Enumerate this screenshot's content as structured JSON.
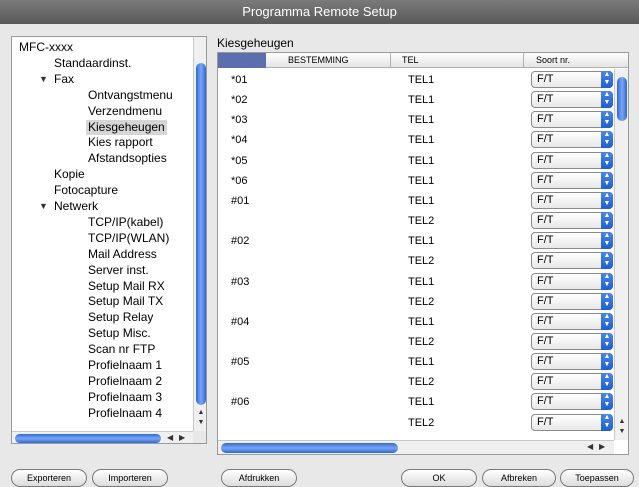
{
  "window": {
    "title": "Programma Remote Setup"
  },
  "tree": {
    "items": [
      {
        "label": "MFC-xxxx",
        "level": 0,
        "expanded": true
      },
      {
        "label": "Standaardinst.",
        "level": 1
      },
      {
        "label": "Fax",
        "level": 1,
        "expanded": true
      },
      {
        "label": "Ontvangstmenu",
        "level": 2
      },
      {
        "label": "Verzendmenu",
        "level": 2
      },
      {
        "label": "Kiesgeheugen",
        "level": 2,
        "selected": true
      },
      {
        "label": "Kies rapport",
        "level": 2
      },
      {
        "label": "Afstandsopties",
        "level": 2
      },
      {
        "label": "Kopie",
        "level": 1
      },
      {
        "label": "Fotocapture",
        "level": 1
      },
      {
        "label": "Netwerk",
        "level": 1,
        "expanded": true
      },
      {
        "label": "TCP/IP(kabel)",
        "level": 2
      },
      {
        "label": "TCP/IP(WLAN)",
        "level": 2
      },
      {
        "label": "Mail Address",
        "level": 2
      },
      {
        "label": "Server inst.",
        "level": 2
      },
      {
        "label": "Setup Mail RX",
        "level": 2
      },
      {
        "label": "Setup Mail TX",
        "level": 2
      },
      {
        "label": "Setup Relay",
        "level": 2
      },
      {
        "label": "Setup Misc.",
        "level": 2
      },
      {
        "label": "Scan nr FTP",
        "level": 2
      },
      {
        "label": "Profielnaam 1",
        "level": 2
      },
      {
        "label": "Profielnaam 2",
        "level": 2
      },
      {
        "label": "Profielnaam 3",
        "level": 2
      },
      {
        "label": "Profielnaam 4",
        "level": 2
      }
    ]
  },
  "main": {
    "section_title": "Kiesgeheugen",
    "columns": [
      "BESTEMMING",
      "TEL",
      "Soort nr."
    ],
    "rows": [
      {
        "id": "*01",
        "tel": "TEL1",
        "type": "F/T"
      },
      {
        "id": "*02",
        "tel": "TEL1",
        "type": "F/T"
      },
      {
        "id": "*03",
        "tel": "TEL1",
        "type": "F/T"
      },
      {
        "id": "*04",
        "tel": "TEL1",
        "type": "F/T"
      },
      {
        "id": "*05",
        "tel": "TEL1",
        "type": "F/T"
      },
      {
        "id": "*06",
        "tel": "TEL1",
        "type": "F/T"
      },
      {
        "id": "#01",
        "tel": "TEL1",
        "type": "F/T"
      },
      {
        "id": "",
        "tel": "TEL2",
        "type": "F/T"
      },
      {
        "id": "#02",
        "tel": "TEL1",
        "type": "F/T"
      },
      {
        "id": "",
        "tel": "TEL2",
        "type": "F/T"
      },
      {
        "id": "#03",
        "tel": "TEL1",
        "type": "F/T"
      },
      {
        "id": "",
        "tel": "TEL2",
        "type": "F/T"
      },
      {
        "id": "#04",
        "tel": "TEL1",
        "type": "F/T"
      },
      {
        "id": "",
        "tel": "TEL2",
        "type": "F/T"
      },
      {
        "id": "#05",
        "tel": "TEL1",
        "type": "F/T"
      },
      {
        "id": "",
        "tel": "TEL2",
        "type": "F/T"
      },
      {
        "id": "#06",
        "tel": "TEL1",
        "type": "F/T"
      },
      {
        "id": "",
        "tel": "TEL2",
        "type": "F/T"
      }
    ]
  },
  "buttons": {
    "export": "Exporteren",
    "import": "Importeren",
    "print": "Afdrukken",
    "ok": "OK",
    "cancel": "Afbreken",
    "apply": "Toepassen"
  },
  "icons": {
    "disclosure": "disclosure-triangle-icon",
    "select_arrow": "up-down-arrows-icon"
  }
}
